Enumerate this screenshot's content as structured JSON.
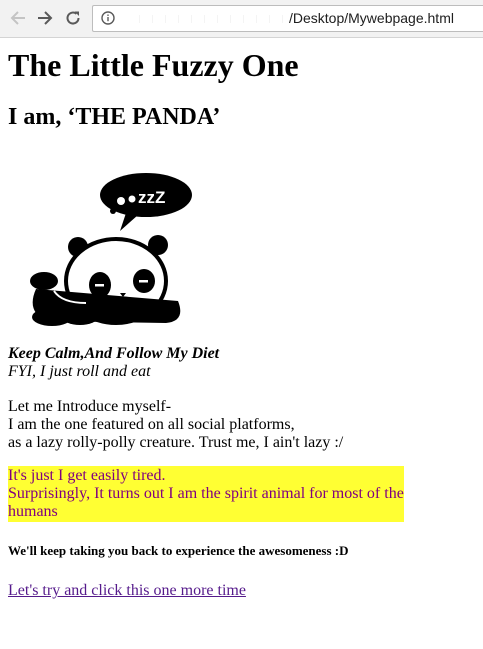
{
  "browser": {
    "url": "/Desktop/Mywebpage.html",
    "icons": {
      "back": "arrow-left-icon",
      "forward": "arrow-right-icon",
      "reload": "reload-icon",
      "info": "info-circle-icon"
    }
  },
  "page": {
    "title": "The Little Fuzzy One",
    "subtitle": "I am, ‘THE PANDA’",
    "image": "sleeping-panda-image",
    "motto": {
      "bold_line": "Keep Calm,And Follow My Diet",
      "italic_line": "FYI, I just roll and eat"
    },
    "intro": [
      "Let me Introduce myself-",
      "I am the one featured on all social platforms,",
      "as a lazy rolly-polly creature. Trust me, I ain't lazy :/"
    ],
    "highlight": {
      "lines": [
        "It's just I get easily tired.",
        "Surprisingly, It turns out I am the spirit animal for most of the humans"
      ],
      "background": "#ffff33",
      "text_color": "#800080"
    },
    "small_note": "We'll keep taking you back to experience the awesomeness :D",
    "link_text": "Let's try and click this one more time",
    "link_color": "#551a8b"
  }
}
